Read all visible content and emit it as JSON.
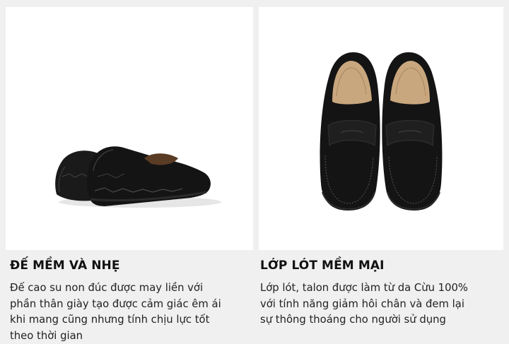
{
  "features": [
    {
      "title": "ĐẾ MỀM VÀ NHẸ",
      "description_lines": [
        "Đế cao su non đúc được may liền với",
        "phần thân giày tạo được cảm giác êm ái",
        "khi mang cũng nhưng tính chịu lực tốt",
        "theo thời gian"
      ],
      "image": "black-leather-loafers-rear-side-view"
    },
    {
      "title": "LỚP LÓT MỀM MẠI",
      "description_lines": [
        "Lớp lót, talon được làm từ da Cừu 100%",
        "với tính năng giảm hôi chân và đem lại",
        "sự thông thoáng cho người sử dụng"
      ],
      "image": "black-leather-penny-loafers-top-view"
    }
  ],
  "colors": {
    "page_background": "#f0f0f0",
    "image_background": "#ffffff",
    "shoe_leather": "#151515",
    "lining": "#c9a77e"
  }
}
